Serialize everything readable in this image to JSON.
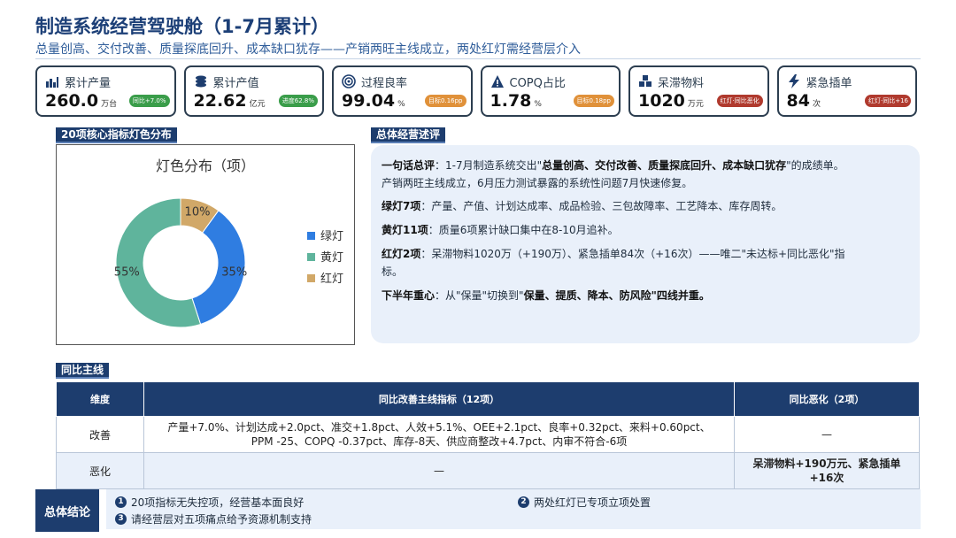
{
  "header": {
    "title": "制造系统经营驾驶舱（1-7月累计）",
    "subtitle": "总量创高、交付改善、质量探底回升、成本缺口犹存——产销两旺主线成立，两处红灯需经营层介入"
  },
  "kpis": [
    {
      "label": "累计产量",
      "value": "260.0",
      "unit": "万台",
      "badge": "同比+7.0%",
      "badge_color": "#3a9d4a",
      "icon": "bar-chart-icon"
    },
    {
      "label": "累计产值",
      "value": "22.62",
      "unit": "亿元",
      "badge": "进度62.8%",
      "badge_color": "#3a9d4a",
      "icon": "coins-icon"
    },
    {
      "label": "过程良率",
      "value": "99.04",
      "unit": "%",
      "badge": "目标0.16pp",
      "badge_color": "#e0913a",
      "icon": "target-icon"
    },
    {
      "label": "COPQ占比",
      "value": "1.78",
      "unit": "%",
      "badge": "目标0.18pp",
      "badge_color": "#e0913a",
      "icon": "warning-icon"
    },
    {
      "label": "呆滞物料",
      "value": "1020",
      "unit": "万元",
      "badge": "红灯·同比恶化",
      "badge_color": "#b03a2e",
      "icon": "boxes-icon"
    },
    {
      "label": "紧急插单",
      "value": "84",
      "unit": "次",
      "badge": "红灯·同比+16",
      "badge_color": "#b03a2e",
      "icon": "lightning-icon"
    }
  ],
  "sections": {
    "lights": "20项核心指标灯色分布",
    "review": "总体经营述评",
    "yoy": "同比主线",
    "conclusion": "总体结论"
  },
  "chart_data": {
    "type": "pie",
    "title": "灯色分布（项）",
    "categories": [
      "绿灯",
      "黄灯",
      "红灯"
    ],
    "values": [
      35,
      55,
      10
    ],
    "value_labels": [
      "35%",
      "55%",
      "10%"
    ],
    "colors": [
      "#2f7de1",
      "#5fb49c",
      "#d1a868"
    ],
    "legend": "right"
  },
  "review": {
    "p1_label": "一句话总评",
    "p1_pre": "：1-7月制造系统交出\"",
    "p1_bold": "总量创高、交付改善、质量探底回升、成本缺口犹存",
    "p1_post": "\"的成绩单。",
    "p1_line2": "产销两旺主线成立，6月压力测试暴露的系统性问题7月快速修复。",
    "p2_label": "绿灯7项",
    "p2_text": "：产量、产值、计划达成率、成品检验、三包故障率、工艺降本、库存周转。",
    "p3_label": "黄灯11项",
    "p3_text": "：质量6项累计缺口集中在8-10月追补。",
    "p4_label": "红灯2项",
    "p4_text": "：呆滞物料1020万（+190万）、紧急插单84次（+16次）——唯二\"未达标+同比恶化\"指",
    "p4_line2": "标。",
    "p5_label": "下半年重心",
    "p5_pre": "：从\"保量\"切换到\"",
    "p5_bold": "保量、提质、降本、防风险",
    "p5_post": "\"四线并重。"
  },
  "table": {
    "headers": [
      "维度",
      "同比改善主线指标（12项）",
      "同比恶化（2项）"
    ],
    "rows": [
      {
        "dim": "改善",
        "line1": "产量+7.0%、计划达成+2.0pct、准交+1.8pct、人效+5.1%、OEE+2.1pct、良率+0.32pct、来料+0.60pct、",
        "line2": "PPM -25、COPQ -0.37pct、库存-8天、供应商整改+4.7pct、内审不符合-6项",
        "worse": "—"
      },
      {
        "dim": "恶化",
        "improve": "—",
        "worse1": "呆滞物料+190万元、紧急插单",
        "worse2": "+16次"
      }
    ]
  },
  "conclusion": {
    "n1": "1",
    "item1": "20项指标无失控项，经营基本面良好",
    "n2": "2",
    "item2": "两处红灯已专项立项处置",
    "n3": "3",
    "item3": "请经营层对五项痛点给予资源机制支持"
  }
}
